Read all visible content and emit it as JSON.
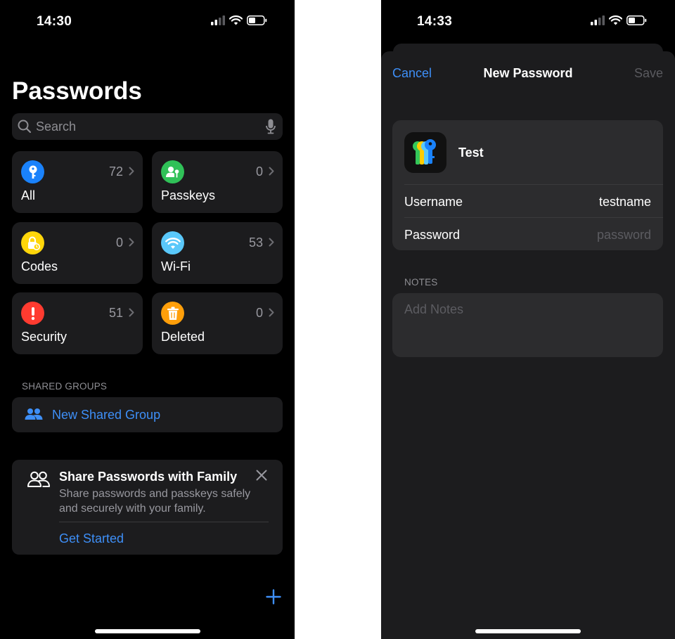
{
  "left": {
    "status": {
      "time": "14:30"
    },
    "title": "Passwords",
    "search": {
      "placeholder": "Search"
    },
    "tiles": [
      {
        "label": "All",
        "count": "72",
        "icon": "key-icon",
        "color": "#1a82fb"
      },
      {
        "label": "Passkeys",
        "count": "0",
        "icon": "person-key-icon",
        "color": "#30c158"
      },
      {
        "label": "Codes",
        "count": "0",
        "icon": "lock-clock-icon",
        "color": "#ffd60a"
      },
      {
        "label": "Wi-Fi",
        "count": "53",
        "icon": "wifi-icon",
        "color": "#5ac8fa"
      },
      {
        "label": "Security",
        "count": "51",
        "icon": "exclamation-icon",
        "color": "#ff3b30"
      },
      {
        "label": "Deleted",
        "count": "0",
        "icon": "trash-icon",
        "color": "#ff9f0a"
      }
    ],
    "shared_groups": {
      "header": "SHARED GROUPS",
      "new_group_label": "New Shared Group"
    },
    "family_card": {
      "title": "Share Passwords with Family",
      "description": "Share passwords and passkeys safely and securely with your family.",
      "action": "Get Started"
    }
  },
  "right": {
    "status": {
      "time": "14:33"
    },
    "nav": {
      "cancel": "Cancel",
      "title": "New Password",
      "save": "Save"
    },
    "entry": {
      "title": "Test",
      "username_label": "Username",
      "username_value": "testname",
      "password_label": "Password",
      "password_placeholder": "password"
    },
    "notes": {
      "header": "NOTES",
      "placeholder": "Add Notes"
    }
  },
  "colors": {
    "accent": "#3e8ff7",
    "card": "#1c1c1e",
    "background": "#000000"
  }
}
